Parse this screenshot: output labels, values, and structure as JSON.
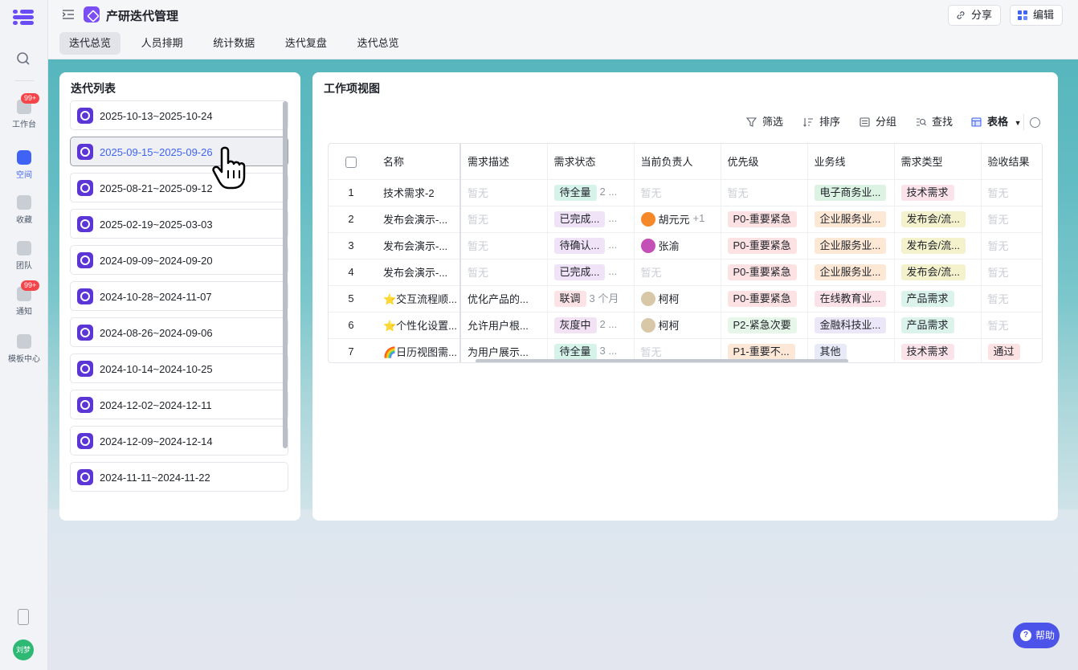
{
  "rail": {
    "items": [
      {
        "label": "工作台",
        "badge": "99+"
      },
      {
        "label": "空间",
        "badge": ""
      },
      {
        "label": "收藏",
        "badge": ""
      },
      {
        "label": "团队",
        "badge": ""
      },
      {
        "label": "通知",
        "badge": "99+"
      },
      {
        "label": "模板中心",
        "badge": ""
      }
    ],
    "avatar_text": "刘梦"
  },
  "header": {
    "title": "产研迭代管理",
    "share_label": "分享",
    "edit_label": "编辑",
    "tabs": [
      "迭代总览",
      "人员排期",
      "统计数据",
      "迭代复盘",
      "迭代总览"
    ]
  },
  "iterations": {
    "title": "迭代列表",
    "items": [
      "2025-10-13~2025-10-24",
      "2025-09-15~2025-09-26",
      "2025-08-21~2025-09-12",
      "2025-02-19~2025-03-03",
      "2024-09-09~2024-09-20",
      "2024-10-28~2024-11-07",
      "2024-08-26~2024-09-06",
      "2024-10-14~2024-10-25",
      "2024-12-02~2024-12-11",
      "2024-12-09~2024-12-14",
      "2024-11-11~2024-11-22"
    ],
    "selected_index": 1
  },
  "workview": {
    "title": "工作项视图",
    "toolbar": {
      "filter": "筛选",
      "sort": "排序",
      "group": "分组",
      "find": "查找",
      "view": "表格"
    },
    "columns": [
      "名称",
      "需求描述",
      "需求状态",
      "当前负责人",
      "优先级",
      "业务线",
      "需求类型",
      "验收结果"
    ],
    "rows": [
      {
        "no": "1",
        "name": "技术需求-2",
        "desc": "暂无",
        "status": "待全量",
        "status_extra": "2 ...",
        "owner": "暂无",
        "owner_extra": "",
        "priority": "暂无",
        "line": "电子商务业...",
        "type": "技术需求",
        "result": "暂无"
      },
      {
        "no": "2",
        "name": "发布会演示-...",
        "desc": "暂无",
        "status": "已完成...",
        "status_extra": "...",
        "owner": "胡元元",
        "owner_extra": "+1",
        "priority": "P0-重要紧急",
        "line": "企业服务业...",
        "type": "发布会/流...",
        "result": "暂无"
      },
      {
        "no": "3",
        "name": "发布会演示-...",
        "desc": "暂无",
        "status": "待确认...",
        "status_extra": "...",
        "owner": "张渝",
        "owner_extra": "",
        "priority": "P0-重要紧急",
        "line": "企业服务业...",
        "type": "发布会/流...",
        "result": "暂无"
      },
      {
        "no": "4",
        "name": "发布会演示-...",
        "desc": "暂无",
        "status": "已完成...",
        "status_extra": "...",
        "owner": "暂无",
        "owner_extra": "",
        "priority": "P0-重要紧急",
        "line": "企业服务业...",
        "type": "发布会/流...",
        "result": "暂无"
      },
      {
        "no": "5",
        "name": "⭐交互流程顺...",
        "desc": "优化产品的...",
        "status": "联调",
        "status_extra": "3 个月",
        "owner": "柯柯",
        "owner_extra": "",
        "priority": "P0-重要紧急",
        "line": "在线教育业...",
        "type": "产品需求",
        "result": "暂无"
      },
      {
        "no": "6",
        "name": "⭐个性化设置...",
        "desc": "允许用户根...",
        "status": "灰度中",
        "status_extra": "2 ...",
        "owner": "柯柯",
        "owner_extra": "",
        "priority": "P2-紧急次要",
        "line": "金融科技业...",
        "type": "产品需求",
        "result": "暂无"
      },
      {
        "no": "7",
        "name": "🌈日历视图需...",
        "desc": "为用户展示...",
        "status": "待全量",
        "status_extra": "3 ...",
        "owner": "暂无",
        "owner_extra": "",
        "priority": "P1-重要不...",
        "line": "其他",
        "type": "技术需求",
        "result": "通过"
      }
    ]
  },
  "colors": {
    "accent": "#3f63f5",
    "status": {
      "待全量": "#d6f3ea",
      "已完成...": "#f1e3f7",
      "待确认...": "#f1e3f7",
      "联调": "#fbe3e6",
      "灰度中": "#f3e2f3"
    },
    "priority": {
      "P0-重要紧急": "#fde2e4",
      "P2-紧急次要": "#e6f6e9",
      "P1-重要不...": "#fde8d7"
    },
    "line": {
      "电子商务业...": "#dcf3e4",
      "企业服务业...": "#fde8d6",
      "在线教育业...": "#fbe1e8",
      "金融科技业...": "#ece7f8",
      "其他": "#e8eaf7"
    },
    "type": {
      "技术需求": "#fbe3ea",
      "发布会/流...": "#f4f2cc",
      "产品需求": "#dcf3ec"
    },
    "result": {
      "通过": "#fde2e4"
    }
  },
  "help_label": "帮助"
}
